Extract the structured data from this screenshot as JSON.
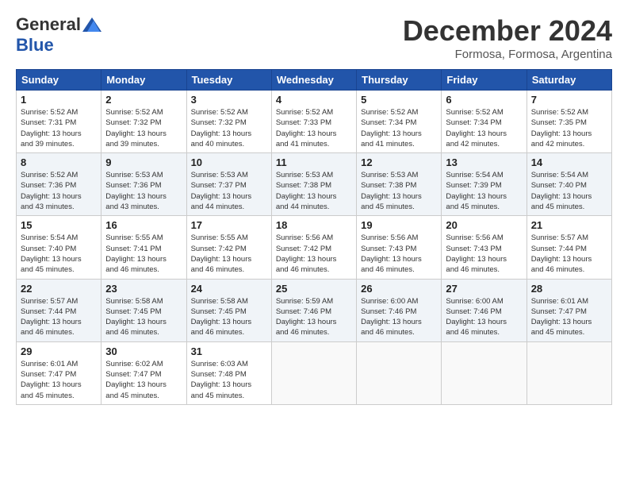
{
  "header": {
    "logo_general": "General",
    "logo_blue": "Blue",
    "month_title": "December 2024",
    "location": "Formosa, Formosa, Argentina"
  },
  "weekdays": [
    "Sunday",
    "Monday",
    "Tuesday",
    "Wednesday",
    "Thursday",
    "Friday",
    "Saturday"
  ],
  "weeks": [
    [
      {
        "day": "1",
        "sunrise": "5:52 AM",
        "sunset": "7:31 PM",
        "daylight": "13 hours and 39 minutes."
      },
      {
        "day": "2",
        "sunrise": "5:52 AM",
        "sunset": "7:32 PM",
        "daylight": "13 hours and 39 minutes."
      },
      {
        "day": "3",
        "sunrise": "5:52 AM",
        "sunset": "7:32 PM",
        "daylight": "13 hours and 40 minutes."
      },
      {
        "day": "4",
        "sunrise": "5:52 AM",
        "sunset": "7:33 PM",
        "daylight": "13 hours and 41 minutes."
      },
      {
        "day": "5",
        "sunrise": "5:52 AM",
        "sunset": "7:34 PM",
        "daylight": "13 hours and 41 minutes."
      },
      {
        "day": "6",
        "sunrise": "5:52 AM",
        "sunset": "7:34 PM",
        "daylight": "13 hours and 42 minutes."
      },
      {
        "day": "7",
        "sunrise": "5:52 AM",
        "sunset": "7:35 PM",
        "daylight": "13 hours and 42 minutes."
      }
    ],
    [
      {
        "day": "8",
        "sunrise": "5:52 AM",
        "sunset": "7:36 PM",
        "daylight": "13 hours and 43 minutes."
      },
      {
        "day": "9",
        "sunrise": "5:53 AM",
        "sunset": "7:36 PM",
        "daylight": "13 hours and 43 minutes."
      },
      {
        "day": "10",
        "sunrise": "5:53 AM",
        "sunset": "7:37 PM",
        "daylight": "13 hours and 44 minutes."
      },
      {
        "day": "11",
        "sunrise": "5:53 AM",
        "sunset": "7:38 PM",
        "daylight": "13 hours and 44 minutes."
      },
      {
        "day": "12",
        "sunrise": "5:53 AM",
        "sunset": "7:38 PM",
        "daylight": "13 hours and 45 minutes."
      },
      {
        "day": "13",
        "sunrise": "5:54 AM",
        "sunset": "7:39 PM",
        "daylight": "13 hours and 45 minutes."
      },
      {
        "day": "14",
        "sunrise": "5:54 AM",
        "sunset": "7:40 PM",
        "daylight": "13 hours and 45 minutes."
      }
    ],
    [
      {
        "day": "15",
        "sunrise": "5:54 AM",
        "sunset": "7:40 PM",
        "daylight": "13 hours and 45 minutes."
      },
      {
        "day": "16",
        "sunrise": "5:55 AM",
        "sunset": "7:41 PM",
        "daylight": "13 hours and 46 minutes."
      },
      {
        "day": "17",
        "sunrise": "5:55 AM",
        "sunset": "7:42 PM",
        "daylight": "13 hours and 46 minutes."
      },
      {
        "day": "18",
        "sunrise": "5:56 AM",
        "sunset": "7:42 PM",
        "daylight": "13 hours and 46 minutes."
      },
      {
        "day": "19",
        "sunrise": "5:56 AM",
        "sunset": "7:43 PM",
        "daylight": "13 hours and 46 minutes."
      },
      {
        "day": "20",
        "sunrise": "5:56 AM",
        "sunset": "7:43 PM",
        "daylight": "13 hours and 46 minutes."
      },
      {
        "day": "21",
        "sunrise": "5:57 AM",
        "sunset": "7:44 PM",
        "daylight": "13 hours and 46 minutes."
      }
    ],
    [
      {
        "day": "22",
        "sunrise": "5:57 AM",
        "sunset": "7:44 PM",
        "daylight": "13 hours and 46 minutes."
      },
      {
        "day": "23",
        "sunrise": "5:58 AM",
        "sunset": "7:45 PM",
        "daylight": "13 hours and 46 minutes."
      },
      {
        "day": "24",
        "sunrise": "5:58 AM",
        "sunset": "7:45 PM",
        "daylight": "13 hours and 46 minutes."
      },
      {
        "day": "25",
        "sunrise": "5:59 AM",
        "sunset": "7:46 PM",
        "daylight": "13 hours and 46 minutes."
      },
      {
        "day": "26",
        "sunrise": "6:00 AM",
        "sunset": "7:46 PM",
        "daylight": "13 hours and 46 minutes."
      },
      {
        "day": "27",
        "sunrise": "6:00 AM",
        "sunset": "7:46 PM",
        "daylight": "13 hours and 46 minutes."
      },
      {
        "day": "28",
        "sunrise": "6:01 AM",
        "sunset": "7:47 PM",
        "daylight": "13 hours and 45 minutes."
      }
    ],
    [
      {
        "day": "29",
        "sunrise": "6:01 AM",
        "sunset": "7:47 PM",
        "daylight": "13 hours and 45 minutes."
      },
      {
        "day": "30",
        "sunrise": "6:02 AM",
        "sunset": "7:47 PM",
        "daylight": "13 hours and 45 minutes."
      },
      {
        "day": "31",
        "sunrise": "6:03 AM",
        "sunset": "7:48 PM",
        "daylight": "13 hours and 45 minutes."
      },
      null,
      null,
      null,
      null
    ]
  ]
}
